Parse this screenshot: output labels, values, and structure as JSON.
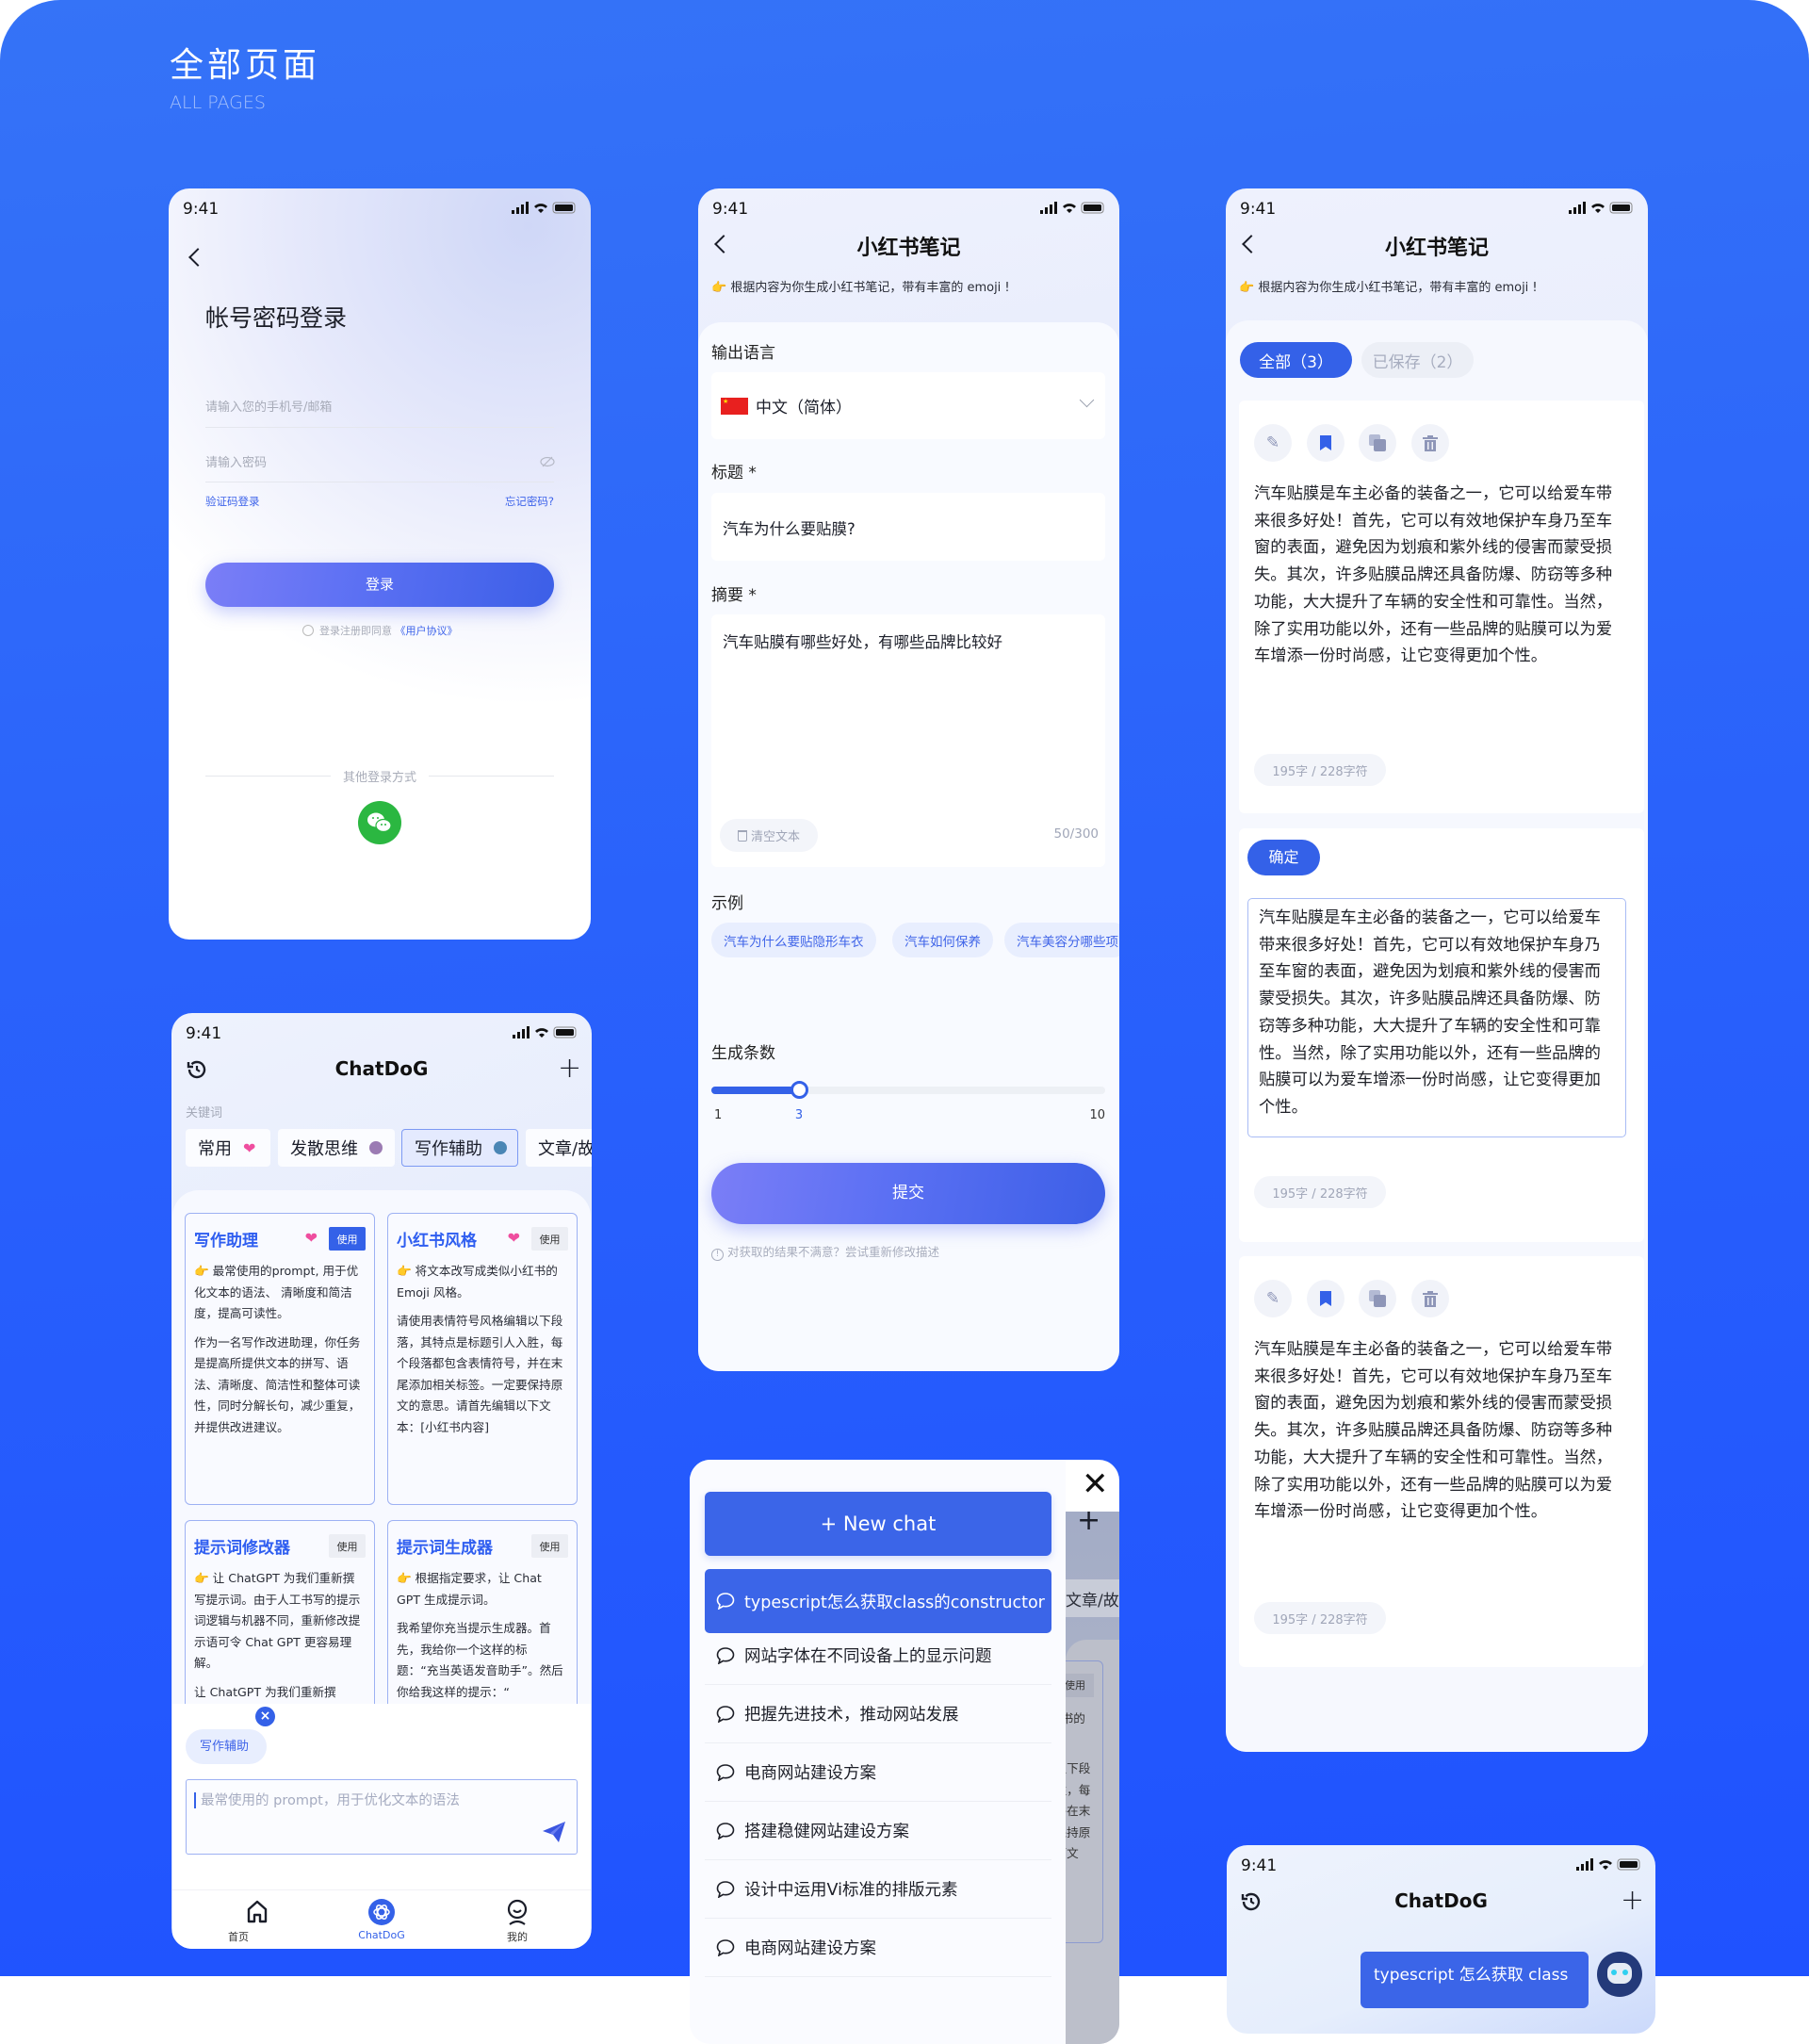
{
  "page": {
    "title": "全部页面",
    "subtitle": "ALL PAGES"
  },
  "status": {
    "time": "9:41"
  },
  "colors": {
    "accent": "#3461e8",
    "background": "#2a62fb",
    "wechat": "#2bb741",
    "heart": "#ef4e9f"
  },
  "login": {
    "title": "帐号密码登录",
    "phone_placeholder": "请输入您的手机号/邮箱",
    "password_placeholder": "请输入密码",
    "sms_login": "验证码登录",
    "forgot": "忘记密码?",
    "login_button": "登录",
    "agreement_prefix": "登录注册即同意",
    "agreement_link": "《用户协议》",
    "other_methods": "其他登录方式"
  },
  "prompts": {
    "title": "ChatDoG",
    "keyword_label": "关键词",
    "chips": [
      {
        "label": "常用",
        "icon": "heart-icon",
        "color": "#ef4e9f"
      },
      {
        "label": "发散思维",
        "color": "#9b7bb3"
      },
      {
        "label": "写作辅助",
        "color": "#4a86b5",
        "selected": true
      },
      {
        "label": "文章/故"
      }
    ],
    "cards": [
      {
        "title": "写作助理",
        "liked": true,
        "use": "使用",
        "active": true,
        "desc": "👉 最常使用的prompt, 用于优化文本的语法、 清晰度和简洁度，提高可读性。",
        "body": "作为一名写作改进助理，你任务是提高所提供文本的拼写、语法、清晰度、简洁性和整体可读性，同时分解长句，减少重复，并提供改进建议。"
      },
      {
        "title": "小红书风格",
        "liked": true,
        "use": "使用",
        "desc": "👉 将文本改写成类似小红书的 Emoji 风格。",
        "body": "请使用表情符号风格编辑以下段落，其特点是标题引人入胜，每个段落都包含表情符号，并在末尾添加相关标签。一定要保持原文的意思。请首先编辑以下文本：[小红书内容]"
      },
      {
        "title": "提示词修改器",
        "use": "使用",
        "desc": "👉 让 ChatGPT 为我们重新撰写提示词。由于人工书写的提示词逻辑与机器不同，重新修改提示语可令 Chat GPT 更容易理解。",
        "body": "让 ChatGPT 为我们重新撰"
      },
      {
        "title": "提示词生成器",
        "use": "使用",
        "desc": "👉 根据指定要求，让 Chat GPT 生成提示词。",
        "body": "我希望你充当提示生成器。首先，我给你一个这样的标题：“充当英语发音助手”。然后你给我这样的提示：“"
      }
    ],
    "selected_tag": "写作辅助",
    "input_placeholder": "最常使用的 prompt，用于优化文本的语法",
    "tabs": [
      {
        "label": "首页"
      },
      {
        "label": "ChatDoG",
        "active": true
      },
      {
        "label": "我的"
      }
    ]
  },
  "form": {
    "title": "小红书笔记",
    "subtitle": "👉 根据内容为你生成小红书笔记，带有丰富的 emoji !",
    "lang_label": "输出语言",
    "lang_value": "中文（简体）",
    "title_label": "标题 *",
    "title_value": "汽车为什么要贴膜?",
    "summary_label": "摘要 *",
    "summary_value": "汽车贴膜有哪些好处，有哪些品牌比较好",
    "clear_label": "清空文本",
    "char_count": "50/300",
    "examples_label": "示例",
    "examples": [
      "汽车为什么要贴隐形车衣",
      "汽车如何保养",
      "汽车美容分哪些项"
    ],
    "count_label": "生成条数",
    "slider": {
      "min": 1,
      "max": 10,
      "value": 3,
      "min_label": "1",
      "value_label": "3",
      "max_label": "10"
    },
    "submit": "提交",
    "hint": "对获取的结果不满意？尝试重新修改描述"
  },
  "history": {
    "new_chat": "+  New chat",
    "items": [
      "typescript怎么获取class的constructor",
      "网站字体在不同设备上的显示问题",
      "把握先进技术，推动网站发展",
      "电商网站建设方案",
      "搭建稳健网站建设方案",
      "设计中运用Vi标准的排版元素",
      "电商网站建设方案"
    ],
    "underlay_chip": "文章/故",
    "underlay_use": "使用"
  },
  "results": {
    "title": "小红书笔记",
    "subtitle": "👉 根据内容为你生成小红书笔记，带有丰富的 emoji !",
    "tabs": [
      {
        "label": "全部（3）",
        "active": true
      },
      {
        "label": "已保存（2）"
      }
    ],
    "confirm": "确定",
    "text": "汽车贴膜是车主必备的装备之一，它可以给爱车带来很多好处！首先，它可以有效地保护车身乃至车窗的表面，避免因为划痕和紫外线的侵害而蒙受损失。其次，许多贴膜品牌还具备防爆、防窃等多种功能，大大提升了车辆的安全性和可靠性。当然，除了实用功能以外，还有一些品牌的贴膜可以为爱车增添一份时尚感，让它变得更加个性。",
    "count": "195字 / 228字符"
  },
  "chat": {
    "title": "ChatDoG",
    "message": "typescript 怎么获取 class"
  }
}
